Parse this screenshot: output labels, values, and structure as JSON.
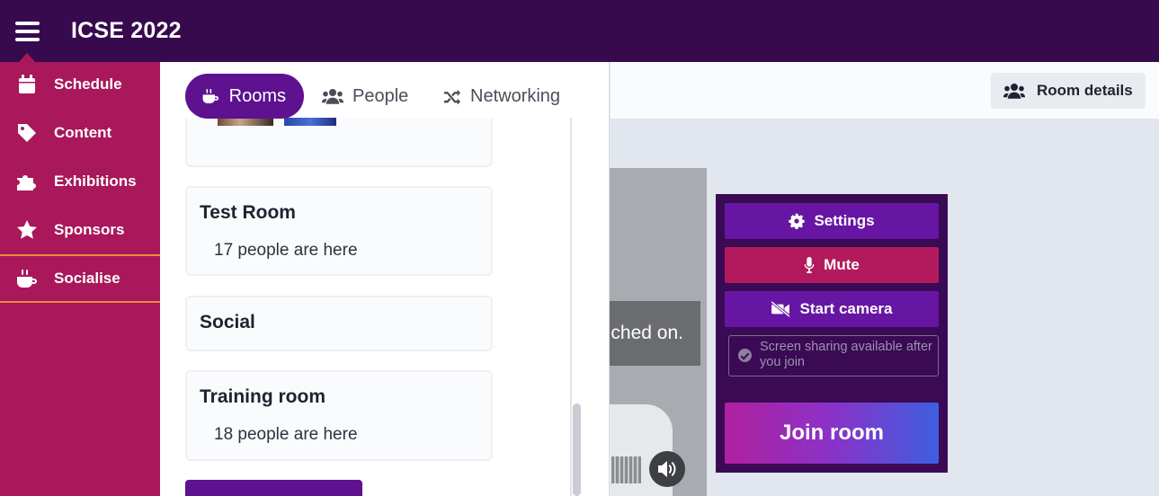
{
  "app": {
    "title": "ICSE 2022"
  },
  "sidebar": {
    "items": [
      {
        "label": "Schedule",
        "icon": "calendar-icon"
      },
      {
        "label": "Content",
        "icon": "tag-icon"
      },
      {
        "label": "Exhibitions",
        "icon": "puzzle-icon"
      },
      {
        "label": "Sponsors",
        "icon": "star-icon"
      },
      {
        "label": "Socialise",
        "icon": "coffee-icon",
        "active": true
      }
    ]
  },
  "panel": {
    "tabs": [
      {
        "label": "Rooms",
        "icon": "coffee-icon",
        "active": true
      },
      {
        "label": "People",
        "icon": "users-icon"
      },
      {
        "label": "Networking",
        "icon": "shuffle-icon"
      }
    ],
    "rooms": [
      {
        "title": "Test Room",
        "count": "17 people are here"
      },
      {
        "title": "Social",
        "count": ""
      },
      {
        "title": "Training room",
        "count": "18 people are here"
      }
    ]
  },
  "main": {
    "room_details_label": "Room details",
    "video_toast": "ched on."
  },
  "join_panel": {
    "settings_label": "Settings",
    "mute_label": "Mute",
    "camera_label": "Start camera",
    "screen_note": "Screen sharing available after you join",
    "join_label": "Join room"
  },
  "colors": {
    "topbar": "#370a4d",
    "sidebar": "#a8185a",
    "accent_purple": "#5e1290",
    "active_border": "#f08a3a"
  }
}
